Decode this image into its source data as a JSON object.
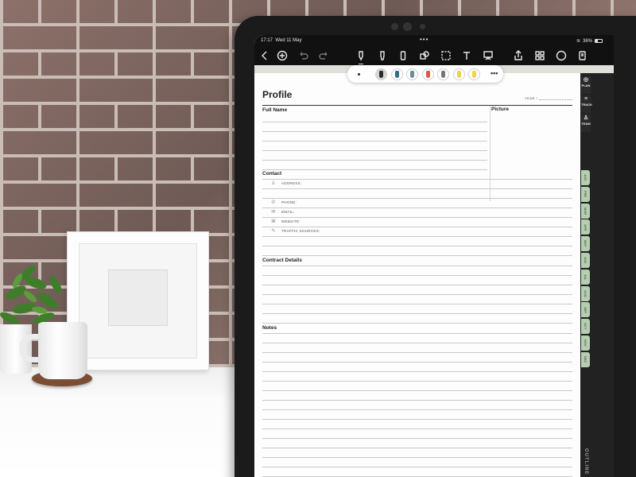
{
  "status": {
    "time": "17:17",
    "date": "Wed 11 May",
    "battery": "36%"
  },
  "toolbar": {
    "back": "chevron-left-icon",
    "add": "plus-circle-icon",
    "undo": "undo-icon",
    "redo": "redo-icon",
    "pen": "pen-icon",
    "highlighter": "highlighter-icon",
    "eraser": "eraser-icon",
    "shapes": "shapes-icon",
    "lasso": "lasso-icon",
    "text": "text-icon",
    "present": "laser-icon",
    "share": "share-icon",
    "grid": "grid-icon",
    "more": "more-icon",
    "export": "export-icon"
  },
  "pens": [
    "#2b2b2b",
    "#2f6e8c",
    "#6a8f98",
    "#d95a4a",
    "#777777",
    "#e4d54a",
    "#f1d640"
  ],
  "sidebar": {
    "top": [
      {
        "label": "PLAN",
        "icon": "◎"
      },
      {
        "label": "TRACK",
        "icon": "≡"
      },
      {
        "label": "TEAM",
        "icon": "♙"
      }
    ],
    "months": [
      "JAN",
      "FEB",
      "MAR",
      "APR",
      "MAY",
      "JUN",
      "JUL",
      "AUG",
      "SEP",
      "OCT",
      "NOV",
      "DEC"
    ],
    "outline": "OUTLINE"
  },
  "page": {
    "title": "Profile",
    "year_label": "YEAR /",
    "full_name": "Full Name",
    "picture": "Picture",
    "contact": "Contact",
    "fields": [
      {
        "icon": "♙",
        "label": "ADDRESS:"
      },
      {
        "icon": "✆",
        "label": "PHONE:"
      },
      {
        "icon": "✉",
        "label": "EMAIL:"
      },
      {
        "icon": "⌘",
        "label": "WEBSITE:"
      },
      {
        "icon": "✎",
        "label": "TRAFFIC SOURCES:"
      }
    ],
    "contract": "Contract Details",
    "notes": "Notes"
  }
}
